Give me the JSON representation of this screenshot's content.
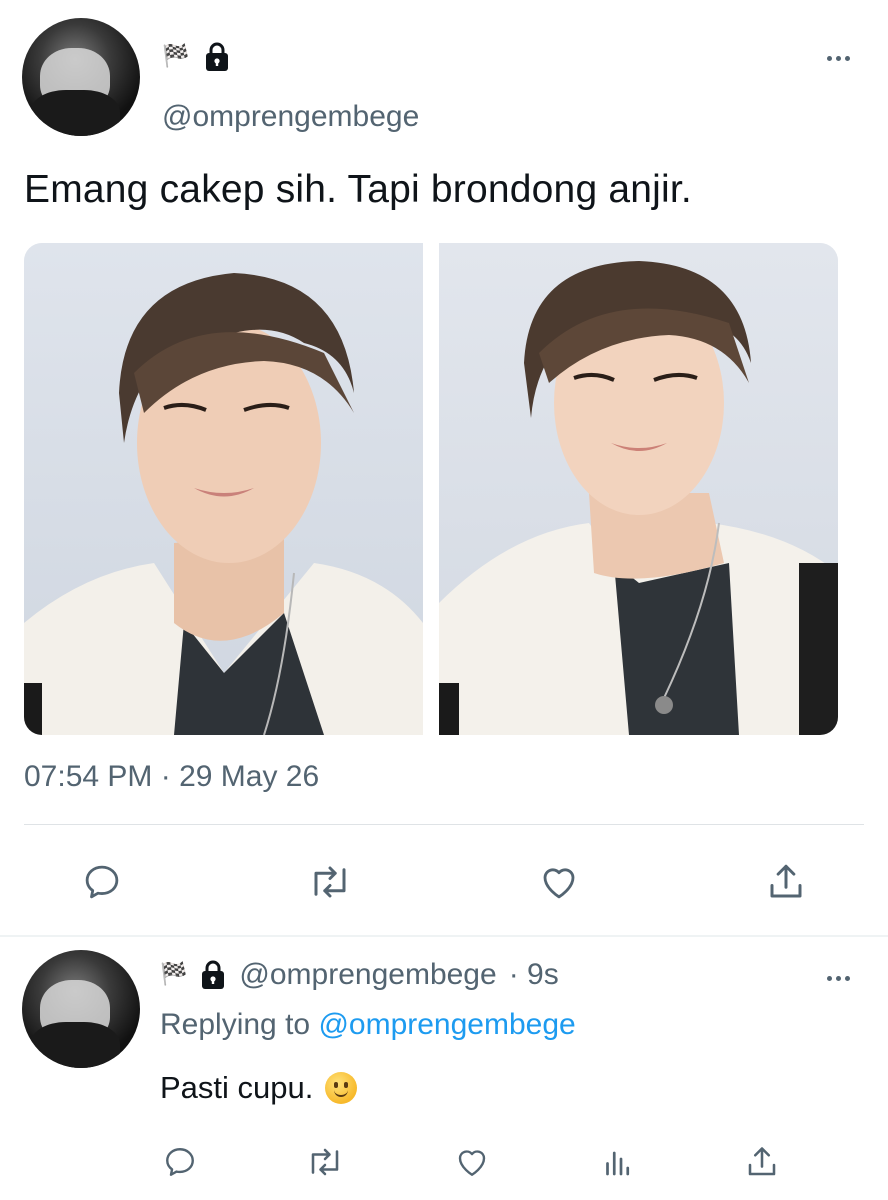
{
  "main_tweet": {
    "handle": "@omprengembege",
    "flag_emoji": "🏁",
    "text": "Emang cakep sih. Tapi brondong anjir.",
    "timestamp": "07:54 PM · 29 May 26",
    "media": [
      "photo-left",
      "photo-right"
    ],
    "actions": [
      "reply-icon",
      "retweet-icon",
      "like-icon",
      "share-icon"
    ]
  },
  "reply": {
    "flag_emoji": "🏁",
    "handle": "@omprengembege",
    "time": "· 9s",
    "replying_label": "Replying to",
    "replying_handle": "@omprengembege",
    "text": "Pasti cupu.",
    "emoji": "slightly-smiling-face-icon",
    "actions": [
      "reply-icon",
      "retweet-icon",
      "like-icon",
      "analytics-icon",
      "share-icon"
    ]
  },
  "colors": {
    "text": "#0f1419",
    "secondary": "#536471",
    "link": "#1d9bf0",
    "divider": "#eff3f4"
  }
}
